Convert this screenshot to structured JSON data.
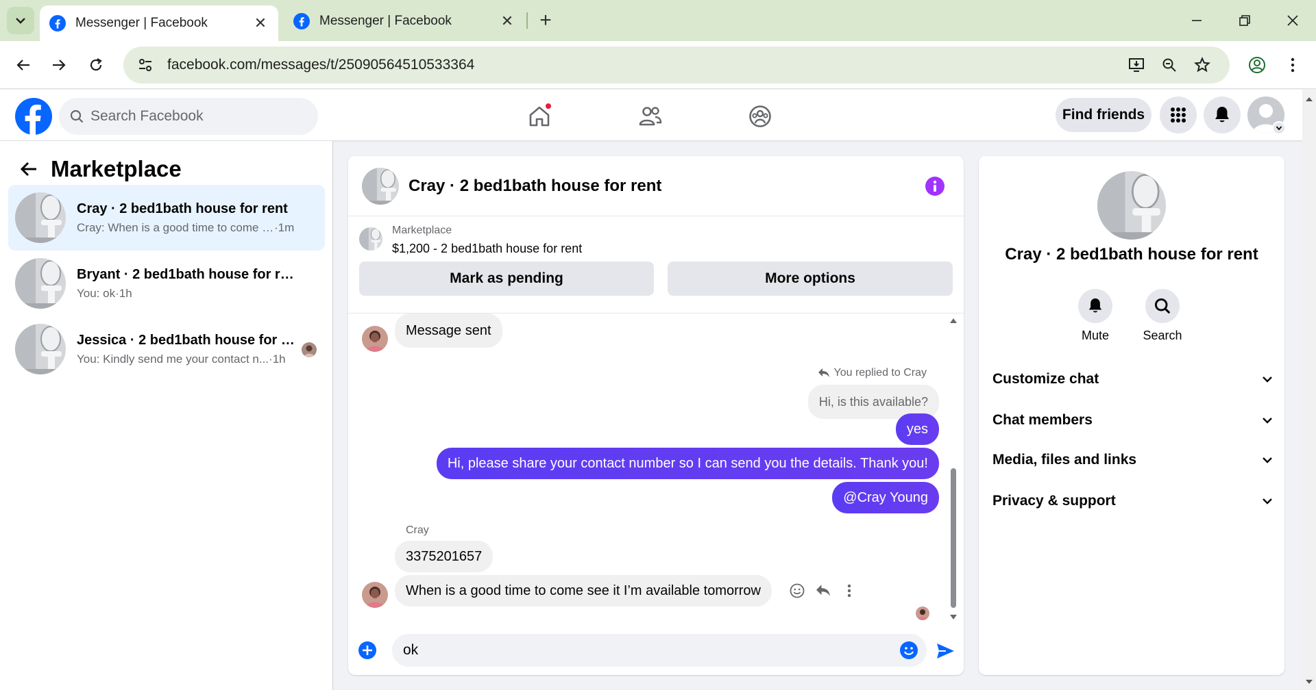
{
  "browser": {
    "tabs": [
      {
        "title": "Messenger | Facebook",
        "active": true
      },
      {
        "title": "Messenger | Facebook",
        "active": false
      }
    ],
    "url": "facebook.com/messages/t/25090564510533364"
  },
  "fb_header": {
    "search_placeholder": "Search Facebook",
    "find_friends_label": "Find friends"
  },
  "marketplace": {
    "title": "Marketplace",
    "conversations": [
      {
        "name": "Cray · 2 bed1bath house for rent",
        "preview": "Cray: When is a good time to come s...",
        "time": "·1m",
        "selected": true
      },
      {
        "name": "Bryant · 2 bed1bath house for rent",
        "preview": "You: ok",
        "time": "·1h",
        "selected": false
      },
      {
        "name": "Jessica · 2 bed1bath house for re...",
        "preview": "You: Kindly send me your contact n...",
        "time": "·1h",
        "selected": false
      }
    ]
  },
  "chat": {
    "title": "Cray · 2 bed1bath house for rent",
    "listing": {
      "source": "Marketplace",
      "price_title": "$1,200 - 2 bed1bath house for rent",
      "mark_pending_label": "Mark as pending",
      "more_options_label": "More options"
    },
    "messages": {
      "system_sent": "Message sent",
      "reply_note": "You replied to Cray",
      "quoted": "Hi, is this available?",
      "out_yes": "yes",
      "out_share": "Hi, please share your contact number so I can send you the details. Thank you!",
      "out_mention": "@Cray Young",
      "sender_name": "Cray",
      "in_number": "3375201657",
      "in_question": "When is a good time to come see it I’m available tomorrow"
    },
    "composer_value": "ok"
  },
  "right_panel": {
    "name": "Cray · 2 bed1bath house for rent",
    "mute_label": "Mute",
    "search_label": "Search",
    "sections": [
      "Customize chat",
      "Chat members",
      "Media, files and links",
      "Privacy & support"
    ]
  },
  "colors": {
    "fb_blue": "#0866ff",
    "outgoing_bubble": "#5b3cf2",
    "info_purple": "#a033ff",
    "selected_row": "#e7f3ff",
    "tab_strip": "#d9e8cf"
  }
}
